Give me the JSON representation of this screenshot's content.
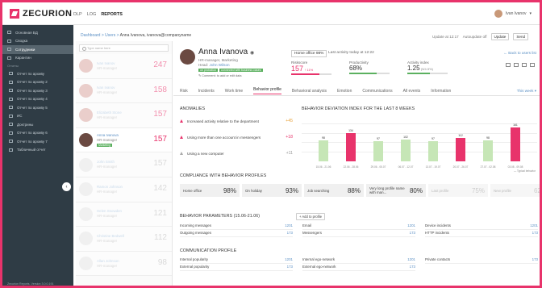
{
  "app": {
    "logo": "ZECURION",
    "nav": [
      "DLP",
      "LOG",
      "REPORTS"
    ],
    "nav_active": 2,
    "user": "Ivan Ivanov"
  },
  "sidebar": {
    "items": [
      {
        "label": "Основная БД"
      },
      {
        "label": "Сводка"
      },
      {
        "label": "Сотрудники",
        "active": true
      },
      {
        "label": "Карантин"
      }
    ],
    "section": "Отчеты",
    "reports": [
      "Отчет по архиву",
      "Отчет по архиву 2",
      "Отчет по архиву 3",
      "Отчет по архиву 4",
      "Отчет по архиву 5",
      "ИС",
      "Доктрины",
      "Отчет по архиву 6",
      "Отчет по архиву 7",
      "Табличный отчет"
    ],
    "footer": "Zecurion Reports. Version 3.0.0.191"
  },
  "breadcrumb": {
    "root": "Dashboard",
    "users": "Users",
    "current": "Anna Ivanova, ivanova@companyname"
  },
  "update": {
    "text": "Update at 12:17",
    "autoupdate": "Autoupdate off",
    "update_btn": "Update",
    "send_btn": "Send"
  },
  "userlist": {
    "search_placeholder": "Type name here",
    "rows": [
      {
        "name": "Ivan Ivanov",
        "role": "HR-manager",
        "score": "247",
        "red": true
      },
      {
        "name": "Ivan Ivanov",
        "role": "HR-manager",
        "score": "158",
        "red": true
      },
      {
        "name": "Elizabeth Stone",
        "role": "HR-manager",
        "score": "157",
        "red": true
      },
      {
        "name": "Anna Ivanova",
        "role": "HR-manager",
        "tag": "Marketing",
        "score": "157",
        "red": true,
        "selected": true
      },
      {
        "name": "John Smith",
        "role": "HR-manager",
        "score": "157",
        "red": false
      },
      {
        "name": "Ramon Johnson",
        "role": "HR-manager",
        "score": "142",
        "red": false
      },
      {
        "name": "Helen Snowden",
        "role": "HR-manager",
        "score": "121",
        "red": false
      },
      {
        "name": "Christine Bedwell",
        "role": "HR-manager",
        "score": "112",
        "red": false
      },
      {
        "name": "Allan Johnson",
        "role": "HR-manager",
        "score": "98",
        "red": false
      }
    ]
  },
  "profile": {
    "name": "Anna Ivanova",
    "role": "HR-manager, Marketing",
    "head_label": "Head:",
    "head": "John Wilson",
    "badges": [
      "on probation",
      "connected with business cases"
    ],
    "comment": "Comment: to add or edit data",
    "office": "Home office 98%",
    "last_activity": "Last activity today at 12:22",
    "back_link": "← Back to users list",
    "metrics": [
      {
        "label": "Riskscore",
        "value": "157",
        "extra": "↑ 11%",
        "fill_pct": 70
      },
      {
        "label": "Productivity",
        "value": "68%",
        "fill_pct": 68
      },
      {
        "label": "Activity index",
        "value": "1.25",
        "extra": "(5/4.5%)",
        "fill_pct": 55
      }
    ]
  },
  "tabs": [
    "Risk",
    "Incidents",
    "Work time",
    "Behavior profile",
    "Behavioral analysis",
    "Emotion",
    "Communications",
    "All events",
    "Information"
  ],
  "tabs_active": 3,
  "this_week": "This week ▾",
  "anomalies": {
    "title": "ANOMALIES",
    "items": [
      {
        "text": "Increased activity relative to the department",
        "value": "+45",
        "level": "o"
      },
      {
        "text": "Using more than one account in messengers",
        "value": "+18",
        "level": "r"
      },
      {
        "text": "Using a new computer",
        "value": "+11",
        "level": "gy"
      }
    ]
  },
  "chart_data": {
    "type": "bar",
    "title": "BEHAVIOR DEVIATION INDEX FOR THE LAST 8 WEEKS",
    "categories": [
      "15.06 - 21.06",
      "22.06 - 28.06",
      "29.06 - 05.07",
      "06.07 - 12.07",
      "13.07 - 19.07",
      "20.07 - 26.07",
      "27.07 - 02.08",
      "03.08 - 09.08"
    ],
    "values": [
      98,
      134,
      97,
      102,
      97,
      112,
      98,
      161
    ],
    "highlight": [
      false,
      true,
      false,
      false,
      false,
      true,
      false,
      true
    ],
    "colors": {
      "normal": "#c6e6b6",
      "deviation": "#e8336b"
    },
    "legend": "— Typical behavior",
    "ylim": [
      0,
      175
    ]
  },
  "compliance": {
    "title": "COMPLIANCE WITH BEHAVIOR PROFILES",
    "items": [
      {
        "label": "Home office",
        "pct": "98%"
      },
      {
        "label": "On holiday",
        "pct": "93%"
      },
      {
        "label": "Job searching",
        "pct": "88%"
      },
      {
        "label": "Very long profile name with man...",
        "pct": "80%"
      },
      {
        "label": "Last profile",
        "pct": "75%",
        "dim": true
      },
      {
        "label": "New profile",
        "pct": "62%",
        "dim": true
      }
    ]
  },
  "params": {
    "title": "BEHAVIOR PARAMETERS (15.06-21.06)",
    "add_btn": "+ Add to profile",
    "cols": [
      [
        {
          "k": "Incoming messages",
          "v": "1201"
        },
        {
          "k": "Outgoing messages",
          "v": "173"
        }
      ],
      [
        {
          "k": "Email",
          "v": "1201"
        },
        {
          "k": "Messengers",
          "v": "173"
        }
      ],
      [
        {
          "k": "Device incidents",
          "v": "1201"
        },
        {
          "k": "HTTP incidents",
          "v": "173"
        }
      ]
    ]
  },
  "comm": {
    "title": "COMMUNICATION PROFILE",
    "cols": [
      [
        {
          "k": "Internal popularity",
          "v": "1201"
        },
        {
          "k": "External popularity",
          "v": "173"
        }
      ],
      [
        {
          "k": "Internal ego-network",
          "v": "1201"
        },
        {
          "k": "External ego-network",
          "v": "173"
        }
      ],
      [
        {
          "k": "Private contacts",
          "v": "173"
        }
      ]
    ]
  }
}
